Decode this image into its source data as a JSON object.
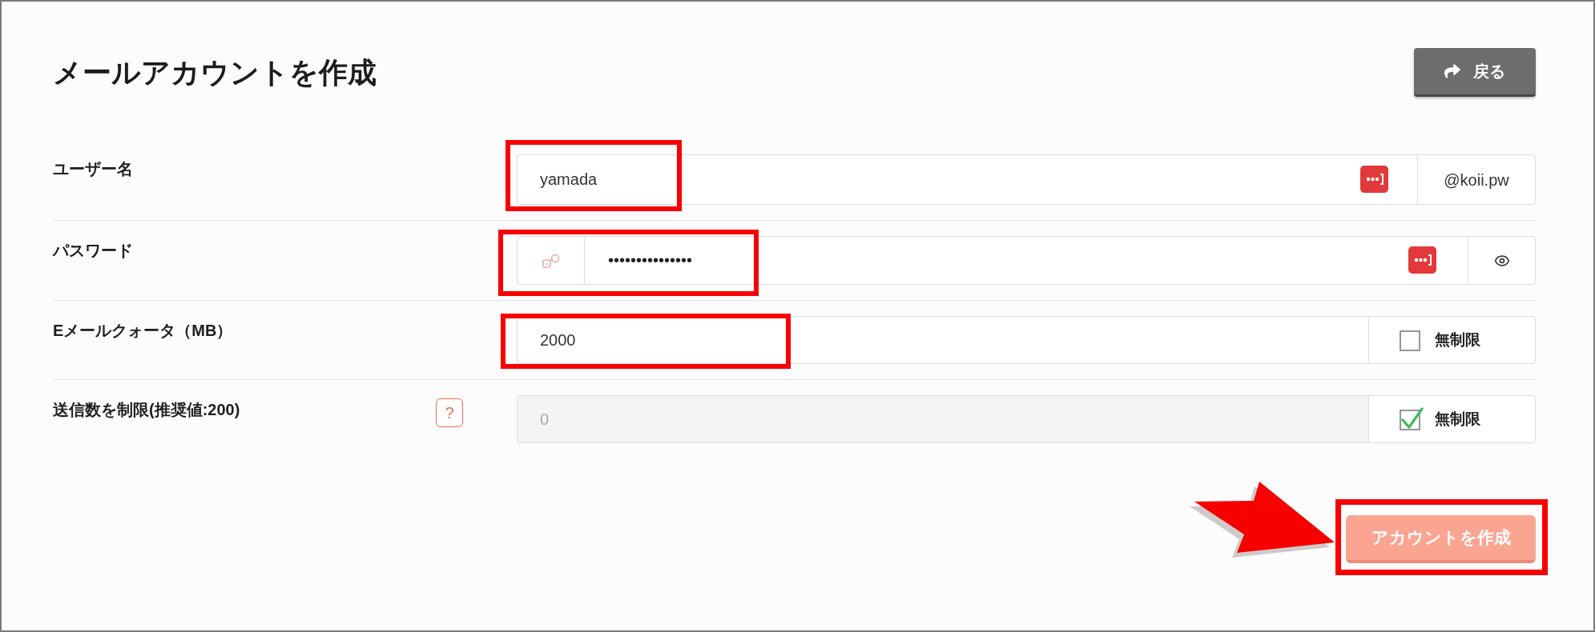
{
  "title": "メールアカウントを作成",
  "back_button": {
    "label": "戻る"
  },
  "fields": [
    {
      "kind": "username",
      "label": "ユーザー名",
      "value": "yamada",
      "suffix": "@koii.pw",
      "highlighted": true
    },
    {
      "kind": "password",
      "label": "パスワード",
      "value": "•••••••••••••••",
      "highlighted": true
    },
    {
      "kind": "quota",
      "label": "Eメールクォータ（MB）",
      "value": "2000",
      "unlimited_label": "無制限",
      "unlimited": false,
      "disabled": false,
      "highlighted": true
    },
    {
      "kind": "quota",
      "label": "送信数を制限(推奨値:200)",
      "help": "?",
      "value": "0",
      "unlimited_label": "無制限",
      "unlimited": true,
      "disabled": true
    }
  ],
  "create_button": {
    "label": "アカウントを作成",
    "disabled": true,
    "highlighted": true,
    "arrow": true
  }
}
